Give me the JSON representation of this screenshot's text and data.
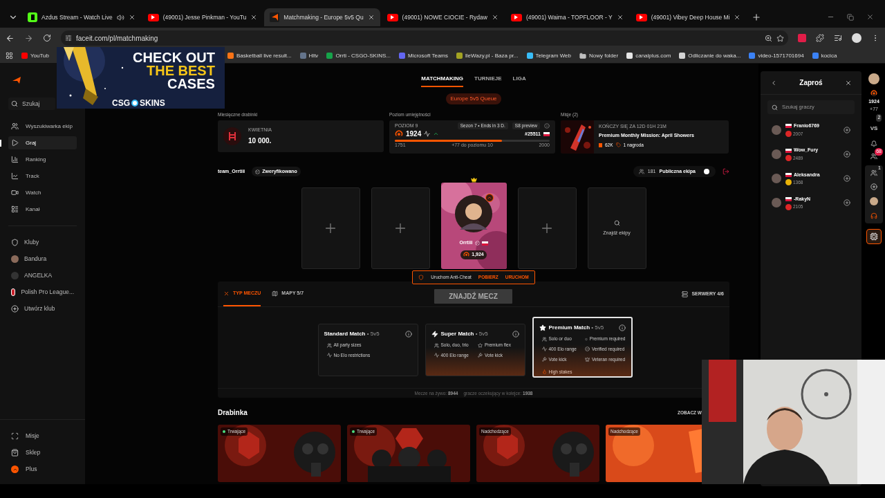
{
  "browser": {
    "tabs": [
      {
        "title": "Azdus Stream - Watch Live",
        "kind": "kick",
        "audio": true,
        "selected": false
      },
      {
        "title": "(49001) Jesse Pinkman - YouTu",
        "kind": "youtube",
        "audio": false,
        "selected": false
      },
      {
        "title": "Matchmaking - Europe 5v5 Qu",
        "kind": "faceit",
        "audio": false,
        "selected": true
      },
      {
        "title": "(49001) NOWE CIOCIE - Rydaw",
        "kind": "youtube",
        "audio": false,
        "selected": false
      },
      {
        "title": "(49001) Waima - TOPFLOOR - Y",
        "kind": "youtube",
        "audio": false,
        "selected": false
      },
      {
        "title": "(49001) Vibey Deep House Mi",
        "kind": "youtube",
        "audio": false,
        "selected": false
      }
    ],
    "url": "faceit.com/pl/matchmaking",
    "bookmarks": [
      {
        "label": "YouTub",
        "kind": "site",
        "color": "#ff0000"
      },
      {
        "label": "Basketball live result...",
        "kind": "site",
        "color": "#f97316"
      },
      {
        "label": "Hltv",
        "kind": "site",
        "color": "#64748b"
      },
      {
        "label": "Orrti - CSGO-SKINS...",
        "kind": "site",
        "color": "#16a34a"
      },
      {
        "label": "Microsoft Teams",
        "kind": "site",
        "color": "#6366f1"
      },
      {
        "label": "lleWazy.pl - Baza pr...",
        "kind": "site",
        "color": "#a3a322"
      },
      {
        "label": "Telegram Web",
        "kind": "site",
        "color": "#38bdf8"
      },
      {
        "label": "Nowy folder",
        "kind": "folder",
        "color": "#c0c0c0"
      },
      {
        "label": "canalplus.com",
        "kind": "site",
        "color": "#e5e5e5"
      },
      {
        "label": "Odliczanie do waka...",
        "kind": "site",
        "color": "#d4d4d4"
      },
      {
        "label": "video-1571701694",
        "kind": "site",
        "color": "#3b82f6"
      },
      {
        "label": "kocica",
        "kind": "site",
        "color": "#3b82f6"
      }
    ]
  },
  "ad_banner": {
    "lines": [
      "CHECK OUT",
      "THE BEST",
      "CASES"
    ],
    "brand": [
      "CSG",
      "SKINS"
    ]
  },
  "sidebar": {
    "search": {
      "placeholder": "Szukaj"
    },
    "nav": [
      {
        "label": "Wyszukiwarka ekip",
        "selected": false
      },
      {
        "label": "Graj",
        "selected": true
      },
      {
        "label": "Ranking",
        "selected": false
      },
      {
        "label": "Track",
        "selected": false
      },
      {
        "label": "Watch",
        "selected": false
      },
      {
        "label": "Kanał",
        "selected": false
      }
    ],
    "clubs": [
      "Kluby",
      "Bandura",
      "ANGELKA",
      "Polish Pro League...",
      "Utwórz klub"
    ],
    "bottom": [
      "Misje",
      "Sklep",
      "Plus"
    ]
  },
  "top_tabs": [
    {
      "label": "MATCHMAKING",
      "selected": true
    },
    {
      "label": "TURNIEJE",
      "selected": false
    },
    {
      "label": "LIGA",
      "selected": false
    }
  ],
  "queue_badge": "Europe 5v5 Queue",
  "ladders": {
    "heading": "Miesięczne drabinki",
    "month": "KWIETNIA",
    "value": "10 000."
  },
  "skill": {
    "heading": "Poziom umiejętności",
    "level_label": "POZIOM 9",
    "season": "Sezon 7 • Ends in 3 D.",
    "preview": "S8 preview",
    "elo": "1924",
    "rank": "#25511",
    "level": 0.69,
    "min": "1751",
    "to_next": "+77 do poziomu 10",
    "max": "2000"
  },
  "missions": {
    "heading": "Misje (2)",
    "ends": "KOŃCZY SIĘ ZA 12D 01H 21M",
    "title": "Premium Monthly Mission: April Showers",
    "points": "62K",
    "reward": "1 nagroda"
  },
  "party": {
    "name": "team_Orrtiii",
    "verified": "Zweryfikowano",
    "members_count": "181",
    "public_label": "Publiczna ekipa",
    "public_on": true,
    "slots": [
      {
        "kind": "empty"
      },
      {
        "kind": "empty"
      },
      {
        "kind": "player",
        "name": "Orrtiii",
        "elo": "1,924"
      },
      {
        "kind": "empty"
      },
      {
        "kind": "find",
        "label": "Znajdź ekipy"
      }
    ]
  },
  "anticheat": {
    "label": "Uruchom Anti-Cheat",
    "download": "POBIERZ",
    "launch": "URUCHOM"
  },
  "panel_tabs": [
    {
      "label": "TYP MECZU",
      "selected": true
    },
    {
      "label": "MAPY 5/7",
      "selected": false
    }
  ],
  "find_button": "ZNAJDŹ MECZ",
  "servers": "SERWERY 4/6",
  "match_types": [
    {
      "name": "Standard Match",
      "format": "• 5v5",
      "kind": "standard",
      "selected": false,
      "features": [
        {
          "kind": "party",
          "text": "All party sizes"
        },
        {
          "kind": "elo",
          "text": "No Elo restrictions"
        }
      ]
    },
    {
      "name": "Super Match",
      "format": "• 5v5",
      "kind": "super",
      "selected": false,
      "features": [
        {
          "kind": "party",
          "text": "Solo, duo, trio"
        },
        {
          "kind": "premium",
          "text": "Premium flex"
        },
        {
          "kind": "elo",
          "text": "400 Elo range"
        },
        {
          "kind": "vote",
          "text": "Vote kick"
        }
      ]
    },
    {
      "name": "Premium Match",
      "format": "• 5v5",
      "kind": "premium",
      "selected": true,
      "features": [
        {
          "kind": "party",
          "text": "Solo or duo"
        },
        {
          "kind": "premium",
          "text": "Premium required"
        },
        {
          "kind": "elo",
          "text": "400 Elo range"
        },
        {
          "kind": "verified",
          "text": "Verified required"
        },
        {
          "kind": "vote",
          "text": "Vote kick"
        },
        {
          "kind": "veteran",
          "text": "Veteran required"
        }
      ],
      "tag": "High stakes"
    }
  ],
  "stats": [
    "Mecze na żywo: **8944**",
    "gracze oczekujący w kolejce: **1938**"
  ],
  "ladder_section": {
    "title": "Drabinka",
    "more": "ZOBACZ W",
    "cards": [
      {
        "status": "Trwające",
        "live": true
      },
      {
        "status": "Trwające",
        "live": true
      },
      {
        "status": "Nadchodzące",
        "live": false
      },
      {
        "status": "Nadchodzące",
        "live": false
      }
    ]
  },
  "invite": {
    "title": "Zaproś",
    "search": {
      "placeholder": "Szukaj graczy"
    },
    "players": [
      {
        "name": "Franio6769",
        "elo": "2007",
        "color": "#dc2626"
      },
      {
        "name": "Wow_Fury",
        "elo": "2489",
        "color": "#dc2626"
      },
      {
        "name": "Aleksandra",
        "elo": "1368",
        "color": "#eab308"
      },
      {
        "name": "-RakyN",
        "elo": "2105",
        "color": "#dc2626"
      }
    ]
  },
  "rail": {
    "elo": "1924",
    "delta": "+77",
    "vs": "VS",
    "vs_badge": "2",
    "party_badge": "68",
    "group_badge": "1"
  }
}
